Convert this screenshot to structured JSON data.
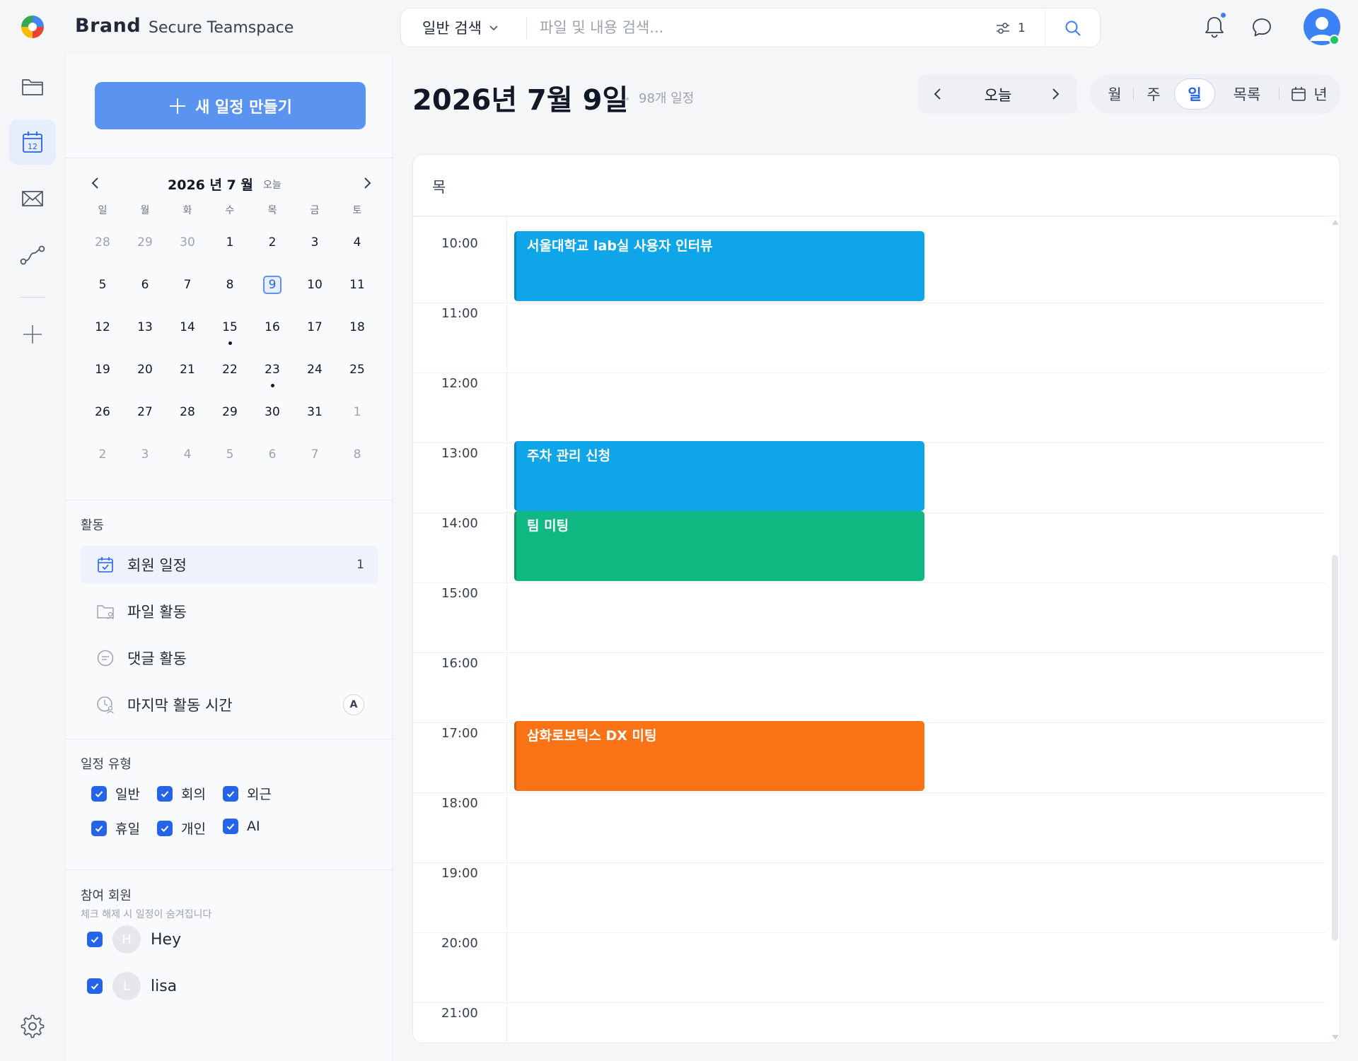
{
  "header": {
    "brand": "Brand",
    "workspace": "Secure Teamspace",
    "search_scope": "일반 검색",
    "search_placeholder": "파일 및 내용 검색...",
    "filter_count": "1",
    "icons": [
      "app-logo-icon",
      "chevron-down-icon",
      "filter-sliders-icon",
      "search-icon",
      "bell-icon",
      "chat-bubble-icon",
      "user-avatar-icon"
    ]
  },
  "rail": {
    "icons": [
      "folder-icon",
      "calendar-icon",
      "mail-icon",
      "route-icon",
      "plus-icon",
      "settings-gear-icon"
    ],
    "calendar_icon_number": "12",
    "active": "calendar"
  },
  "sidebar": {
    "new_event_label": "새 일정 만들기",
    "mini_calendar": {
      "title": "2026 년 7 월",
      "today_label": "오늘",
      "weekdays": [
        "일",
        "월",
        "화",
        "수",
        "목",
        "금",
        "토"
      ],
      "weeks": [
        [
          {
            "d": "28",
            "other": true
          },
          {
            "d": "29",
            "other": true
          },
          {
            "d": "30",
            "other": true
          },
          {
            "d": "1"
          },
          {
            "d": "2"
          },
          {
            "d": "3"
          },
          {
            "d": "4"
          }
        ],
        [
          {
            "d": "5"
          },
          {
            "d": "6"
          },
          {
            "d": "7"
          },
          {
            "d": "8"
          },
          {
            "d": "9",
            "selected": true
          },
          {
            "d": "10"
          },
          {
            "d": "11"
          }
        ],
        [
          {
            "d": "12"
          },
          {
            "d": "13"
          },
          {
            "d": "14"
          },
          {
            "d": "15",
            "dot": true
          },
          {
            "d": "16"
          },
          {
            "d": "17"
          },
          {
            "d": "18"
          }
        ],
        [
          {
            "d": "19"
          },
          {
            "d": "20"
          },
          {
            "d": "21"
          },
          {
            "d": "22"
          },
          {
            "d": "23",
            "dot": true
          },
          {
            "d": "24"
          },
          {
            "d": "25"
          }
        ],
        [
          {
            "d": "26"
          },
          {
            "d": "27"
          },
          {
            "d": "28"
          },
          {
            "d": "29"
          },
          {
            "d": "30"
          },
          {
            "d": "31"
          },
          {
            "d": "1",
            "other": true
          }
        ],
        [
          {
            "d": "2",
            "other": true
          },
          {
            "d": "3",
            "other": true
          },
          {
            "d": "4",
            "other": true
          },
          {
            "d": "5",
            "other": true
          },
          {
            "d": "6",
            "other": true
          },
          {
            "d": "7",
            "other": true
          },
          {
            "d": "8",
            "other": true
          }
        ]
      ]
    },
    "activity": {
      "title": "활동",
      "items": [
        {
          "label": "회원 일정",
          "count": "1",
          "active": true
        },
        {
          "label": "파일 활동"
        },
        {
          "label": "댓글 활동"
        },
        {
          "label": "마지막 활동 시간",
          "badge": "A"
        }
      ]
    },
    "event_types": {
      "title": "일정 유형",
      "items": [
        {
          "label": "일반",
          "checked": true
        },
        {
          "label": "회의",
          "checked": true
        },
        {
          "label": "외근",
          "checked": true
        },
        {
          "label": "휴일",
          "checked": true
        },
        {
          "label": "개인",
          "checked": true
        },
        {
          "label": "AI",
          "checked": true
        }
      ]
    },
    "members": {
      "title": "참여 회원",
      "hint": "체크 해제 시 일정이 숨겨집니다",
      "items": [
        {
          "name": "Hey",
          "initial": "H",
          "checked": true
        },
        {
          "name": "lisa",
          "initial": "L",
          "checked": true
        }
      ]
    }
  },
  "main": {
    "date_title": "2026년 7월 9일",
    "event_count": "98개 일정",
    "nav_today": "오늘",
    "views": [
      "월",
      "주",
      "일",
      "목록",
      "년"
    ],
    "active_view": "일",
    "day_header": "목",
    "hours": [
      "10:00",
      "11:00",
      "12:00",
      "13:00",
      "14:00",
      "15:00",
      "16:00",
      "17:00",
      "18:00",
      "19:00",
      "20:00",
      "21:00"
    ],
    "events": [
      {
        "title": "서울대학교 lab실 사용자 인터뷰",
        "start": "10:00",
        "end": "11:00",
        "color": "#0ea5e9"
      },
      {
        "title": "주차 관리 신청",
        "start": "13:00",
        "end": "14:00",
        "color": "#0ea5e9"
      },
      {
        "title": "팀 미팅",
        "start": "14:00",
        "end": "15:00",
        "color": "#10b981"
      },
      {
        "title": "삼화로보틱스 DX 미팅",
        "start": "17:00",
        "end": "18:00",
        "color": "#f97316"
      }
    ]
  },
  "colors": {
    "accent": "#5b93f0",
    "primary": "#2563eb",
    "status_online": "#22c55e"
  }
}
